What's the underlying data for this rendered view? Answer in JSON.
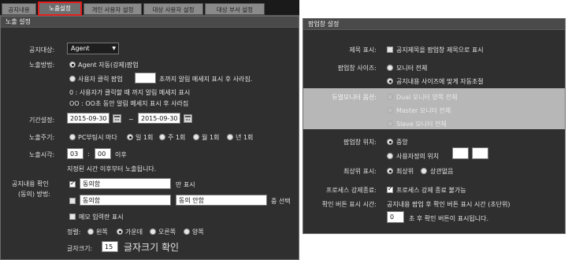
{
  "tabs": [
    "공지내용",
    "노출설정",
    "개인 사용자 설정",
    "대상 사용자 설정",
    "대상 부서 설정"
  ],
  "left": {
    "title": "노출 설정",
    "target_label": "공지대상:",
    "target_value": "Agent",
    "method_label": "노출방법:",
    "method_agent": "Agent 자동(강제)팝업",
    "method_user_a": "사용자 클릭 팝업",
    "method_user_b": "초까지 알림 메세지 표시 후 사라짐.",
    "note1": "0 : 사용자가 클릭할 때 까지 알림 메세지 표시",
    "note2": "OO : OO초 동안 알림 메세지 표시 후 사라짐",
    "period_label": "기간설정:",
    "date_start": "2015-09-30",
    "date_sep": "~",
    "date_end": "2015-09-30",
    "cycle_label": "노출주기:",
    "cycle_opts": [
      "PC부팅시 마다",
      "일 1회",
      "주 1회",
      "월 1회",
      "년 1회"
    ],
    "time_label": "노출시각:",
    "time_hour": "03",
    "time_colon": ":",
    "time_min": "00",
    "time_after": "이후",
    "time_note": "지정된 시간 이후부터 노출됩니다.",
    "confirm_label1": "공지내용 확인",
    "confirm_label2": "(동의) 방법:",
    "agree_text": "동의함",
    "only_show": "만 표시",
    "agree_text2": "동의함",
    "disagree_text": "동의 안함",
    "choose_one": "중 선택",
    "memo": "메모 입력란 표시",
    "align_label": "정렬:",
    "align_opts": [
      "왼쪽",
      "가운데",
      "오른쪽",
      "양쪽"
    ],
    "fontsize_label": "글자크기:",
    "fontsize_value": "15",
    "fontsize_preview": "글자크기 확인"
  },
  "right": {
    "title": "팝업창 설정",
    "titledisp_label": "제목 표시:",
    "titledisp_opt": "공지제목을 팝업창 제목으로 표시",
    "size_label": "팝업창 사이즈:",
    "size_opts": [
      "모니터 전체",
      "공지내용 사이즈에 맞게 자동조절"
    ],
    "dual_label": "듀얼모니터 옵션:",
    "dual_opts": [
      "Dual 모니터 양쪽 전체",
      "Master 모니터 전체",
      "Slave 모니터 전체"
    ],
    "pos_label": "팝업창 위치:",
    "pos_opts": [
      "중앙",
      "사용자정의 위치"
    ],
    "top_label": "최상위 표시:",
    "top_opts": [
      "최상위",
      "상관없음"
    ],
    "kill_label": "프로세스 강제종료:",
    "kill_opt": "프로세스 강제 종료 불가능",
    "confirm_label": "확인 버튼 표시 시간:",
    "confirm_desc": "공지내용 팝업 후 확인 버튼 표시 시간 (초단위)",
    "confirm_value": "0",
    "confirm_after": "초 후 확인 버튼이 표시됩니다."
  }
}
